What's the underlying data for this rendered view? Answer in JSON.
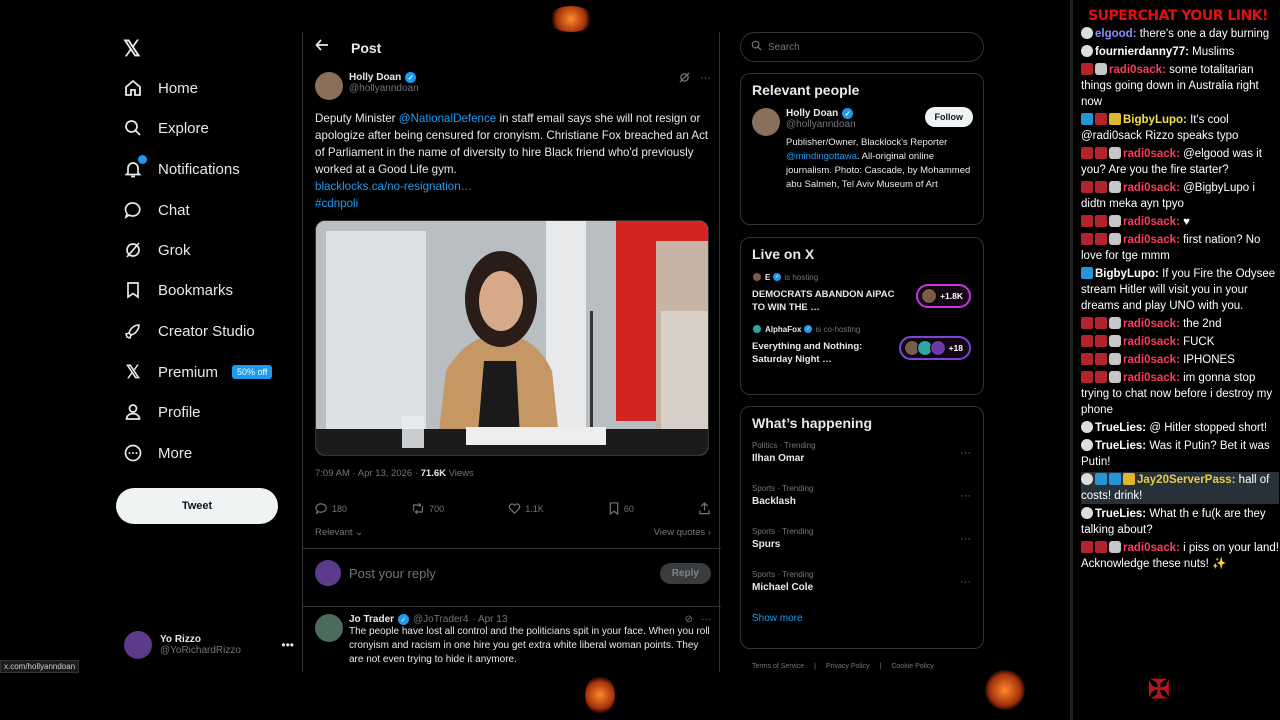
{
  "nav": {
    "items": [
      {
        "label": "Home",
        "icon": "home-icon"
      },
      {
        "label": "Explore",
        "icon": "search-icon"
      },
      {
        "label": "Notifications",
        "icon": "bell-icon"
      },
      {
        "label": "Chat",
        "icon": "chat-bubble-icon"
      },
      {
        "label": "Grok",
        "icon": "grok-icon"
      },
      {
        "label": "Bookmarks",
        "icon": "bookmark-icon"
      },
      {
        "label": "Creator Studio",
        "icon": "rocket-icon"
      },
      {
        "label": "Premium",
        "icon": "x-logo-icon"
      },
      {
        "label": "Profile",
        "icon": "person-icon"
      },
      {
        "label": "More",
        "icon": "more-circle-icon"
      }
    ],
    "premium_badge": "50% off",
    "tweet_button": "Tweet",
    "account": {
      "name": "Yo Rizzo",
      "handle": "@YoRichardRizzo"
    },
    "url_tooltip": "x.com/hollyanndoan"
  },
  "post": {
    "header_title": "Post",
    "author_name": "Holly Doan",
    "author_handle": "@hollyanndoan",
    "text_part1": "Deputy Minister ",
    "mention": "@NationalDefence",
    "text_part2": " in staff email says she will not resign or apologize after being censured for cronyism. Christiane Fox breached an Act of Parliament in the name of diversity to hire Black friend who'd previously worked at a Good Life gym.",
    "link": "blacklocks.ca/no-resignation…",
    "hashtag": "#cdnpoli",
    "time": "7:09 AM · Apr 13, 2026 · ",
    "views_count": "71.6K",
    "views_label": " Views",
    "replies": "180",
    "reposts": "700",
    "likes": "1.1K",
    "bookmarks": "60",
    "sort_label": "Relevant",
    "view_quotes": "View quotes",
    "reply_placeholder": "Post your reply",
    "reply_button": "Reply"
  },
  "reply": {
    "name": "Jo Trader",
    "handle": "@JoTrader4",
    "date": "· Apr 13",
    "text": "The people have lost all control and the politicians spit in your face. When you roll cronyism and racism in one hire you get extra white liberal woman points. They are not even trying to hide it anymore."
  },
  "right": {
    "search_placeholder": "Search",
    "relevant_title": "Relevant people",
    "rp_name": "Holly Doan",
    "rp_handle": "@hollyanndoan",
    "follow": "Follow",
    "bio_part1": "Publisher/Owner, Blacklock's Reporter ",
    "bio_mention": "@mindingottawa",
    "bio_part2": ". All-original online journalism. Photo: Cascade, by Mohammed abu Salmeh, Tel Aviv Museum of Art",
    "live_title": "Live on X",
    "live": [
      {
        "host": "E",
        "host_suffix": "is hosting",
        "title": "DEMOCRATS ABANDON AIPAC TO WIN THE …",
        "count": "+1.8K"
      },
      {
        "host": "AlphaFox",
        "host_suffix": "is co-hosting",
        "title": "Everything and Nothing: Saturday Night …",
        "count": "+18"
      }
    ],
    "happening_title": "What’s happening",
    "trends": [
      {
        "cat": "Politics · Trending",
        "name": "Ilhan Omar"
      },
      {
        "cat": "Sports · Trending",
        "name": "Backlash"
      },
      {
        "cat": "Sports · Trending",
        "name": "Spurs"
      },
      {
        "cat": "Sports · Trending",
        "name": "Michael Cole"
      }
    ],
    "show_more": "Show more",
    "footer": [
      "Terms of Service",
      "Privacy Policy",
      "Cookie Policy"
    ]
  },
  "chat": {
    "title": "SUPERCHAT YOUR LINK!",
    "messages": [
      {
        "user": "elgood:",
        "text": "there's one a day burning",
        "color": "#8a8fff",
        "badges": [
          "mod"
        ]
      },
      {
        "user": "fournierdanny77:",
        "text": "Muslims",
        "color": "#ffffff",
        "badges": [
          "mod"
        ]
      },
      {
        "user": "radi0sack:",
        "text": "some totalitarian things going down in Australia right now",
        "color": "#ff3b5c",
        "badges": [
          "red",
          "grey"
        ]
      },
      {
        "user": "BigbyLupo:",
        "text": "It's cool @radi0sack Rizzo speaks typo",
        "color": "#f4e14b",
        "badges": [
          "blue",
          "red",
          "gold"
        ]
      },
      {
        "user": "radi0sack:",
        "text": "@elgood was it you? Are you the fire starter?",
        "color": "#ff3b5c",
        "badges": [
          "red",
          "red",
          "grey"
        ]
      },
      {
        "user": "radi0sack:",
        "text": "@BigbyLupo i didtn meka ayn tpyo",
        "color": "#ff3b5c",
        "badges": [
          "red",
          "red",
          "grey"
        ]
      },
      {
        "user": "radi0sack:",
        "text": "♥",
        "color": "#ff3b5c",
        "badges": [
          "red",
          "red",
          "grey"
        ]
      },
      {
        "user": "radi0sack:",
        "text": "first nation? No love for tge mmm",
        "color": "#ff3b5c",
        "badges": [
          "red",
          "red",
          "grey"
        ]
      },
      {
        "user": "BigbyLupo:",
        "text": "If you Fire the Odysee stream Hitler will visit you in your dreams and play UNO with you.",
        "color": "#ffffff",
        "badges": [
          "blue"
        ]
      },
      {
        "user": "radi0sack:",
        "text": "the 2nd",
        "color": "#ff3b5c",
        "badges": [
          "red",
          "red",
          "grey"
        ]
      },
      {
        "user": "radi0sack:",
        "text": "FUCK",
        "color": "#ff3b5c",
        "badges": [
          "red",
          "red",
          "grey"
        ]
      },
      {
        "user": "radi0sack:",
        "text": "IPHONES",
        "color": "#ff3b5c",
        "badges": [
          "red",
          "red",
          "grey"
        ]
      },
      {
        "user": "radi0sack:",
        "text": "im gonna stop trying to chat now before i destroy my phone",
        "color": "#ff3b5c",
        "badges": [
          "red",
          "red",
          "grey"
        ]
      },
      {
        "user": "TrueLies:",
        "text": "@ Hitler stopped short!",
        "color": "#ffffff",
        "badges": [
          "mod"
        ]
      },
      {
        "user": "TrueLies:",
        "text": "Was it Putin? Bet it was Putin!",
        "color": "#ffffff",
        "badges": [
          "mod"
        ]
      },
      {
        "user": "Jay20ServerPass:",
        "text": "hall of costs! drink!",
        "color": "#e8c94b",
        "badges": [
          "mod",
          "blue",
          "blue",
          "gold"
        ],
        "highlight": true
      },
      {
        "user": "TrueLies:",
        "text": "What th e fu(k are they talking about?",
        "color": "#ffffff",
        "badges": [
          "mod"
        ]
      },
      {
        "user": "radi0sack:",
        "text": "i piss on your land! Acknowledge these nuts! ✨",
        "color": "#ff3b5c",
        "badges": [
          "red",
          "red",
          "grey"
        ]
      }
    ]
  }
}
